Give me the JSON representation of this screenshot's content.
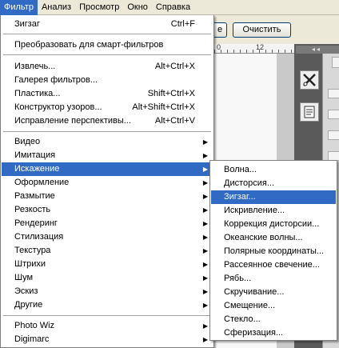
{
  "menubar": {
    "items": [
      "Фильтр",
      "Анализ",
      "Просмотр",
      "Окно",
      "Справка"
    ]
  },
  "background": {
    "cut_button": "е",
    "reset_button": "Очистить",
    "ruler_label": "12",
    "ruler_partial": "0"
  },
  "filter_menu": {
    "last_filter": {
      "label": "Зигзаг",
      "shortcut": "Ctrl+F"
    },
    "smart": {
      "label": "Преобразовать для смарт-фильтров"
    },
    "group1": [
      {
        "label": "Извлечь...",
        "shortcut": "Alt+Ctrl+X"
      },
      {
        "label": "Галерея фильтров...",
        "shortcut": ""
      },
      {
        "label": "Пластика...",
        "shortcut": "Shift+Ctrl+X"
      },
      {
        "label": "Конструктор узоров...",
        "shortcut": "Alt+Shift+Ctrl+X"
      },
      {
        "label": "Исправление перспективы...",
        "shortcut": "Alt+Ctrl+V"
      }
    ],
    "group2": [
      {
        "label": "Видео"
      },
      {
        "label": "Имитация"
      },
      {
        "label": "Искажение"
      },
      {
        "label": "Оформление"
      },
      {
        "label": "Размытие"
      },
      {
        "label": "Резкость"
      },
      {
        "label": "Рендеринг"
      },
      {
        "label": "Стилизация"
      },
      {
        "label": "Текстура"
      },
      {
        "label": "Штрихи"
      },
      {
        "label": "Шум"
      },
      {
        "label": "Эскиз"
      },
      {
        "label": "Другие"
      }
    ],
    "group3": [
      {
        "label": "Photo Wiz"
      },
      {
        "label": "Digimarc"
      }
    ]
  },
  "distort_submenu": {
    "items": [
      "Волна...",
      "Дисторсия...",
      "Зигзаг...",
      "Искривление...",
      "Коррекция дисторсии...",
      "Океанские волны...",
      "Полярные координаты...",
      "Рассеянное свечение...",
      "Рябь...",
      "Скручивание...",
      "Смещение...",
      "Стекло...",
      "Сферизация..."
    ]
  },
  "colors": {
    "highlight": "#316ac5",
    "menubar": "#ece9d8",
    "panel": "#5a5a5a"
  }
}
